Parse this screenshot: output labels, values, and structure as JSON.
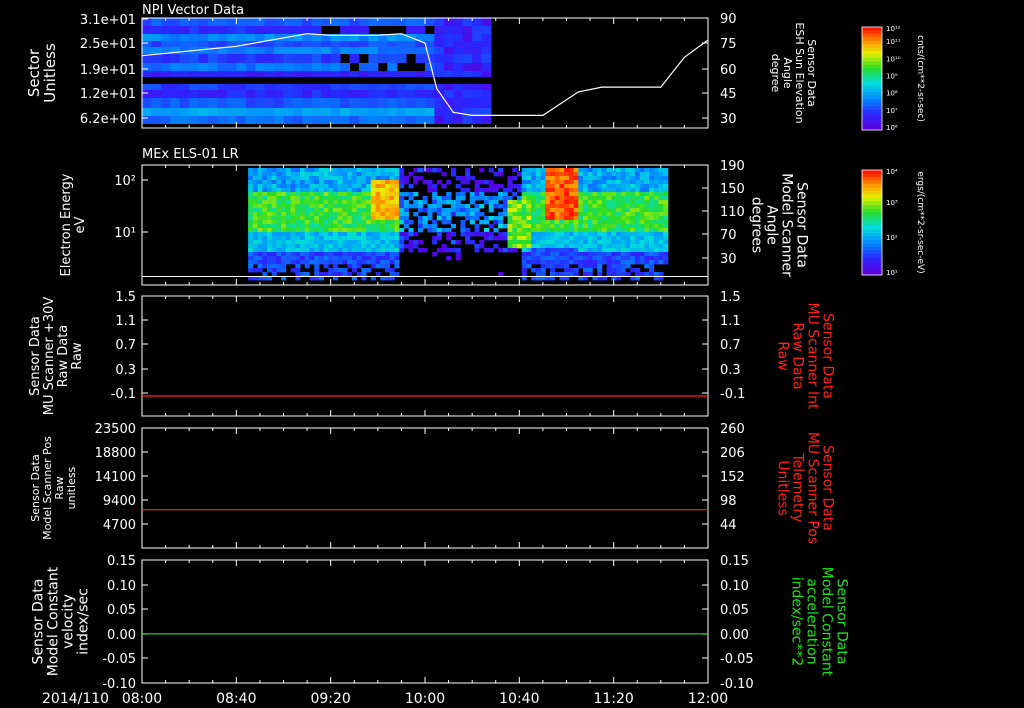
{
  "figure": {
    "date_label": "2014/110",
    "time_ticks": [
      "08:00",
      "08:40",
      "09:20",
      "10:00",
      "10:40",
      "11:20",
      "12:00"
    ],
    "time_range": [
      0,
      240
    ]
  },
  "colors": {
    "white": "#ffffff",
    "red": "#ff2020",
    "green": "#20e020",
    "frame": "#ffffff"
  },
  "panels": [
    {
      "id": "npi",
      "title": "NPI Vector Data",
      "left_label": [
        "Sector",
        "Unitless"
      ],
      "left_ticks": [
        "3.1e+01",
        "2.5e+01",
        "1.9e+01",
        "1.2e+01",
        "6.2e+00"
      ],
      "right_label": [
        "Sensor Data",
        "ESH Sun Elevation",
        "Angle",
        "degree"
      ],
      "right_ticks": [
        "90",
        "75",
        "60",
        "45",
        "30"
      ],
      "right_color": "white",
      "colorbar": {
        "name": "NF",
        "top": "10¹²",
        "labels": [
          "10¹¹",
          "10¹⁰",
          "10⁹",
          "10⁸",
          "10⁷",
          "10⁶"
        ],
        "unit": "cnts/(cm**2-sr-sec)"
      }
    },
    {
      "id": "els",
      "title": "MEx ELS-01 LR",
      "left_label": [
        "Electron Energy",
        "eV"
      ],
      "left_ticks": [
        "10²",
        "10¹"
      ],
      "right_label": [
        "Sensor Data",
        "Model Scanner",
        "Angle",
        "degrees"
      ],
      "right_ticks": [
        "190",
        "150",
        "110",
        "70",
        "30"
      ],
      "right_color": "white",
      "colorbar": {
        "name": "DEF",
        "top": "10⁴",
        "labels": [
          "10³",
          "10²",
          "10¹"
        ],
        "unit": "ergs/(cm**2-sr-sec-eV)"
      }
    },
    {
      "id": "mu30",
      "title": "",
      "left_label": [
        "Sensor Data",
        "MU Scanner +30V",
        "Raw Data",
        "Raw"
      ],
      "left_ticks": [
        "1.5",
        "1.1",
        "0.7",
        "0.3",
        "-0.1"
      ],
      "right_label": [
        "Sensor Data",
        "MU Scanner Int",
        "Raw Data",
        "Raw"
      ],
      "right_ticks": [
        "1.5",
        "1.1",
        "0.7",
        "0.3",
        "-0.1"
      ],
      "right_color": "red"
    },
    {
      "id": "mupos",
      "title": "",
      "left_label": [
        "Sensor Data",
        "Model Scanner Pos",
        "Raw",
        "unitless"
      ],
      "left_ticks": [
        "23500",
        "18800",
        "14100",
        "9400",
        "4700"
      ],
      "right_label": [
        "Sensor Data",
        "MU Scanner Pos",
        "Telemetry",
        "Unitless"
      ],
      "right_ticks": [
        "260",
        "206",
        "152",
        "98",
        "44"
      ],
      "right_color": "red"
    },
    {
      "id": "vel",
      "title": "",
      "left_label": [
        "Sensor Data",
        "Model Constant",
        "velocity",
        "index/sec"
      ],
      "left_ticks": [
        "0.15",
        "0.10",
        "0.05",
        "0.00",
        "-0.05",
        "-0.10"
      ],
      "right_label": [
        "Sensor Data",
        "Model Constant",
        "acceleration",
        "index/sec**2"
      ],
      "right_ticks": [
        "0.15",
        "0.10",
        "0.05",
        "0.00",
        "-0.05",
        "-0.10"
      ],
      "right_color": "green"
    }
  ],
  "chart_data": [
    {
      "type": "heatmap",
      "title": "NPI Vector Data",
      "ylabel": "Sector Unitless",
      "y_ticks": [
        "3.1e+01",
        "2.5e+01",
        "1.9e+01",
        "1.2e+01",
        "6.2e+00"
      ],
      "x_ticks": [
        "08:00",
        "08:40",
        "09:20",
        "10:00",
        "10:40",
        "11:20",
        "12:00"
      ],
      "colorbar": "NF cnts/(cm**2-sr-sec)",
      "line_series": {
        "name": "Sensor Data ESH Sun Elevation Angle",
        "y_axis": "right",
        "ylim": [
          20,
          90
        ],
        "x_minutes": [
          0,
          40,
          70,
          80,
          100,
          110,
          120,
          125,
          132,
          140,
          150,
          170,
          185,
          195,
          210,
          220,
          230,
          240
        ],
        "values": [
          66,
          72,
          80,
          79,
          79,
          80,
          74,
          45,
          30,
          28,
          28,
          28,
          43,
          46,
          46,
          46,
          65,
          76
        ]
      }
    },
    {
      "type": "heatmap",
      "title": "MEx ELS-01 LR",
      "ylabel": "Electron Energy eV",
      "y_scale": "log",
      "y_ticks": [
        "10²",
        "10¹"
      ],
      "x_ticks": [
        "08:00",
        "08:40",
        "09:20",
        "10:00",
        "10:40",
        "11:20",
        "12:00"
      ],
      "colorbar": "DEF ergs/(cm**2-sr-sec-eV)",
      "line_series": {
        "name": "Sensor Data Model Scanner Angle",
        "y_axis": "right",
        "ylim": [
          0,
          190
        ],
        "x_minutes": [
          0,
          240
        ],
        "values": [
          4,
          4
        ]
      }
    },
    {
      "type": "line",
      "ylabel": "Sensor Data MU Scanner +30V Raw Data Raw",
      "ylim": [
        -0.3,
        1.5
      ],
      "series": [
        {
          "name": "Sensor Data MU Scanner Int Raw Data Raw",
          "x_minutes": [
            0,
            240
          ],
          "values": [
            0.0,
            0.0
          ]
        }
      ]
    },
    {
      "type": "line",
      "ylabel": "Sensor Data Model Scanner Pos Raw unitless",
      "ylim": [
        0,
        23500
      ],
      "y2lim": [
        0,
        260
      ],
      "series": [
        {
          "name": "Sensor Data MU Scanner Pos Telemetry Unitless",
          "x_minutes": [
            0,
            240
          ],
          "values": [
            83,
            83
          ],
          "y_axis": "right"
        }
      ]
    },
    {
      "type": "line",
      "ylabel": "Sensor Data Model Constant velocity index/sec",
      "ylim": [
        -0.1,
        0.15
      ],
      "series": [
        {
          "name": "Sensor Data Model Constant acceleration index/sec**2",
          "x_minutes": [
            0,
            240
          ],
          "values": [
            0.0,
            0.0
          ]
        }
      ]
    }
  ]
}
